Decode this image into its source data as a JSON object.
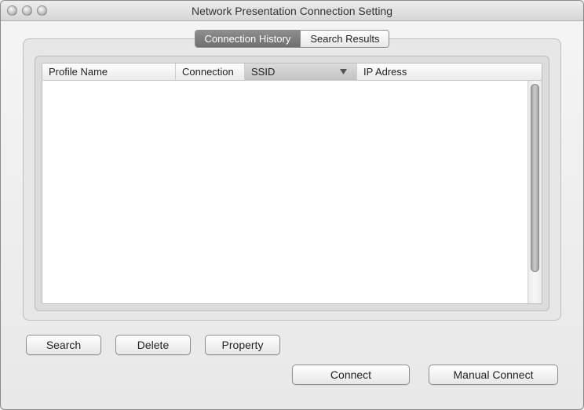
{
  "window": {
    "title": "Network Presentation Connection Setting"
  },
  "tabs": {
    "connection_history": "Connection History",
    "search_results": "Search Results"
  },
  "columns": {
    "profile_name": "Profile Name",
    "connection": "Connection",
    "ssid": "SSID",
    "ip_address": "IP Adress"
  },
  "sorted_column": "ssid",
  "rows": [],
  "buttons": {
    "search": "Search",
    "delete": "Delete",
    "property": "Property",
    "connect": "Connect",
    "manual_connect": "Manual Connect"
  }
}
